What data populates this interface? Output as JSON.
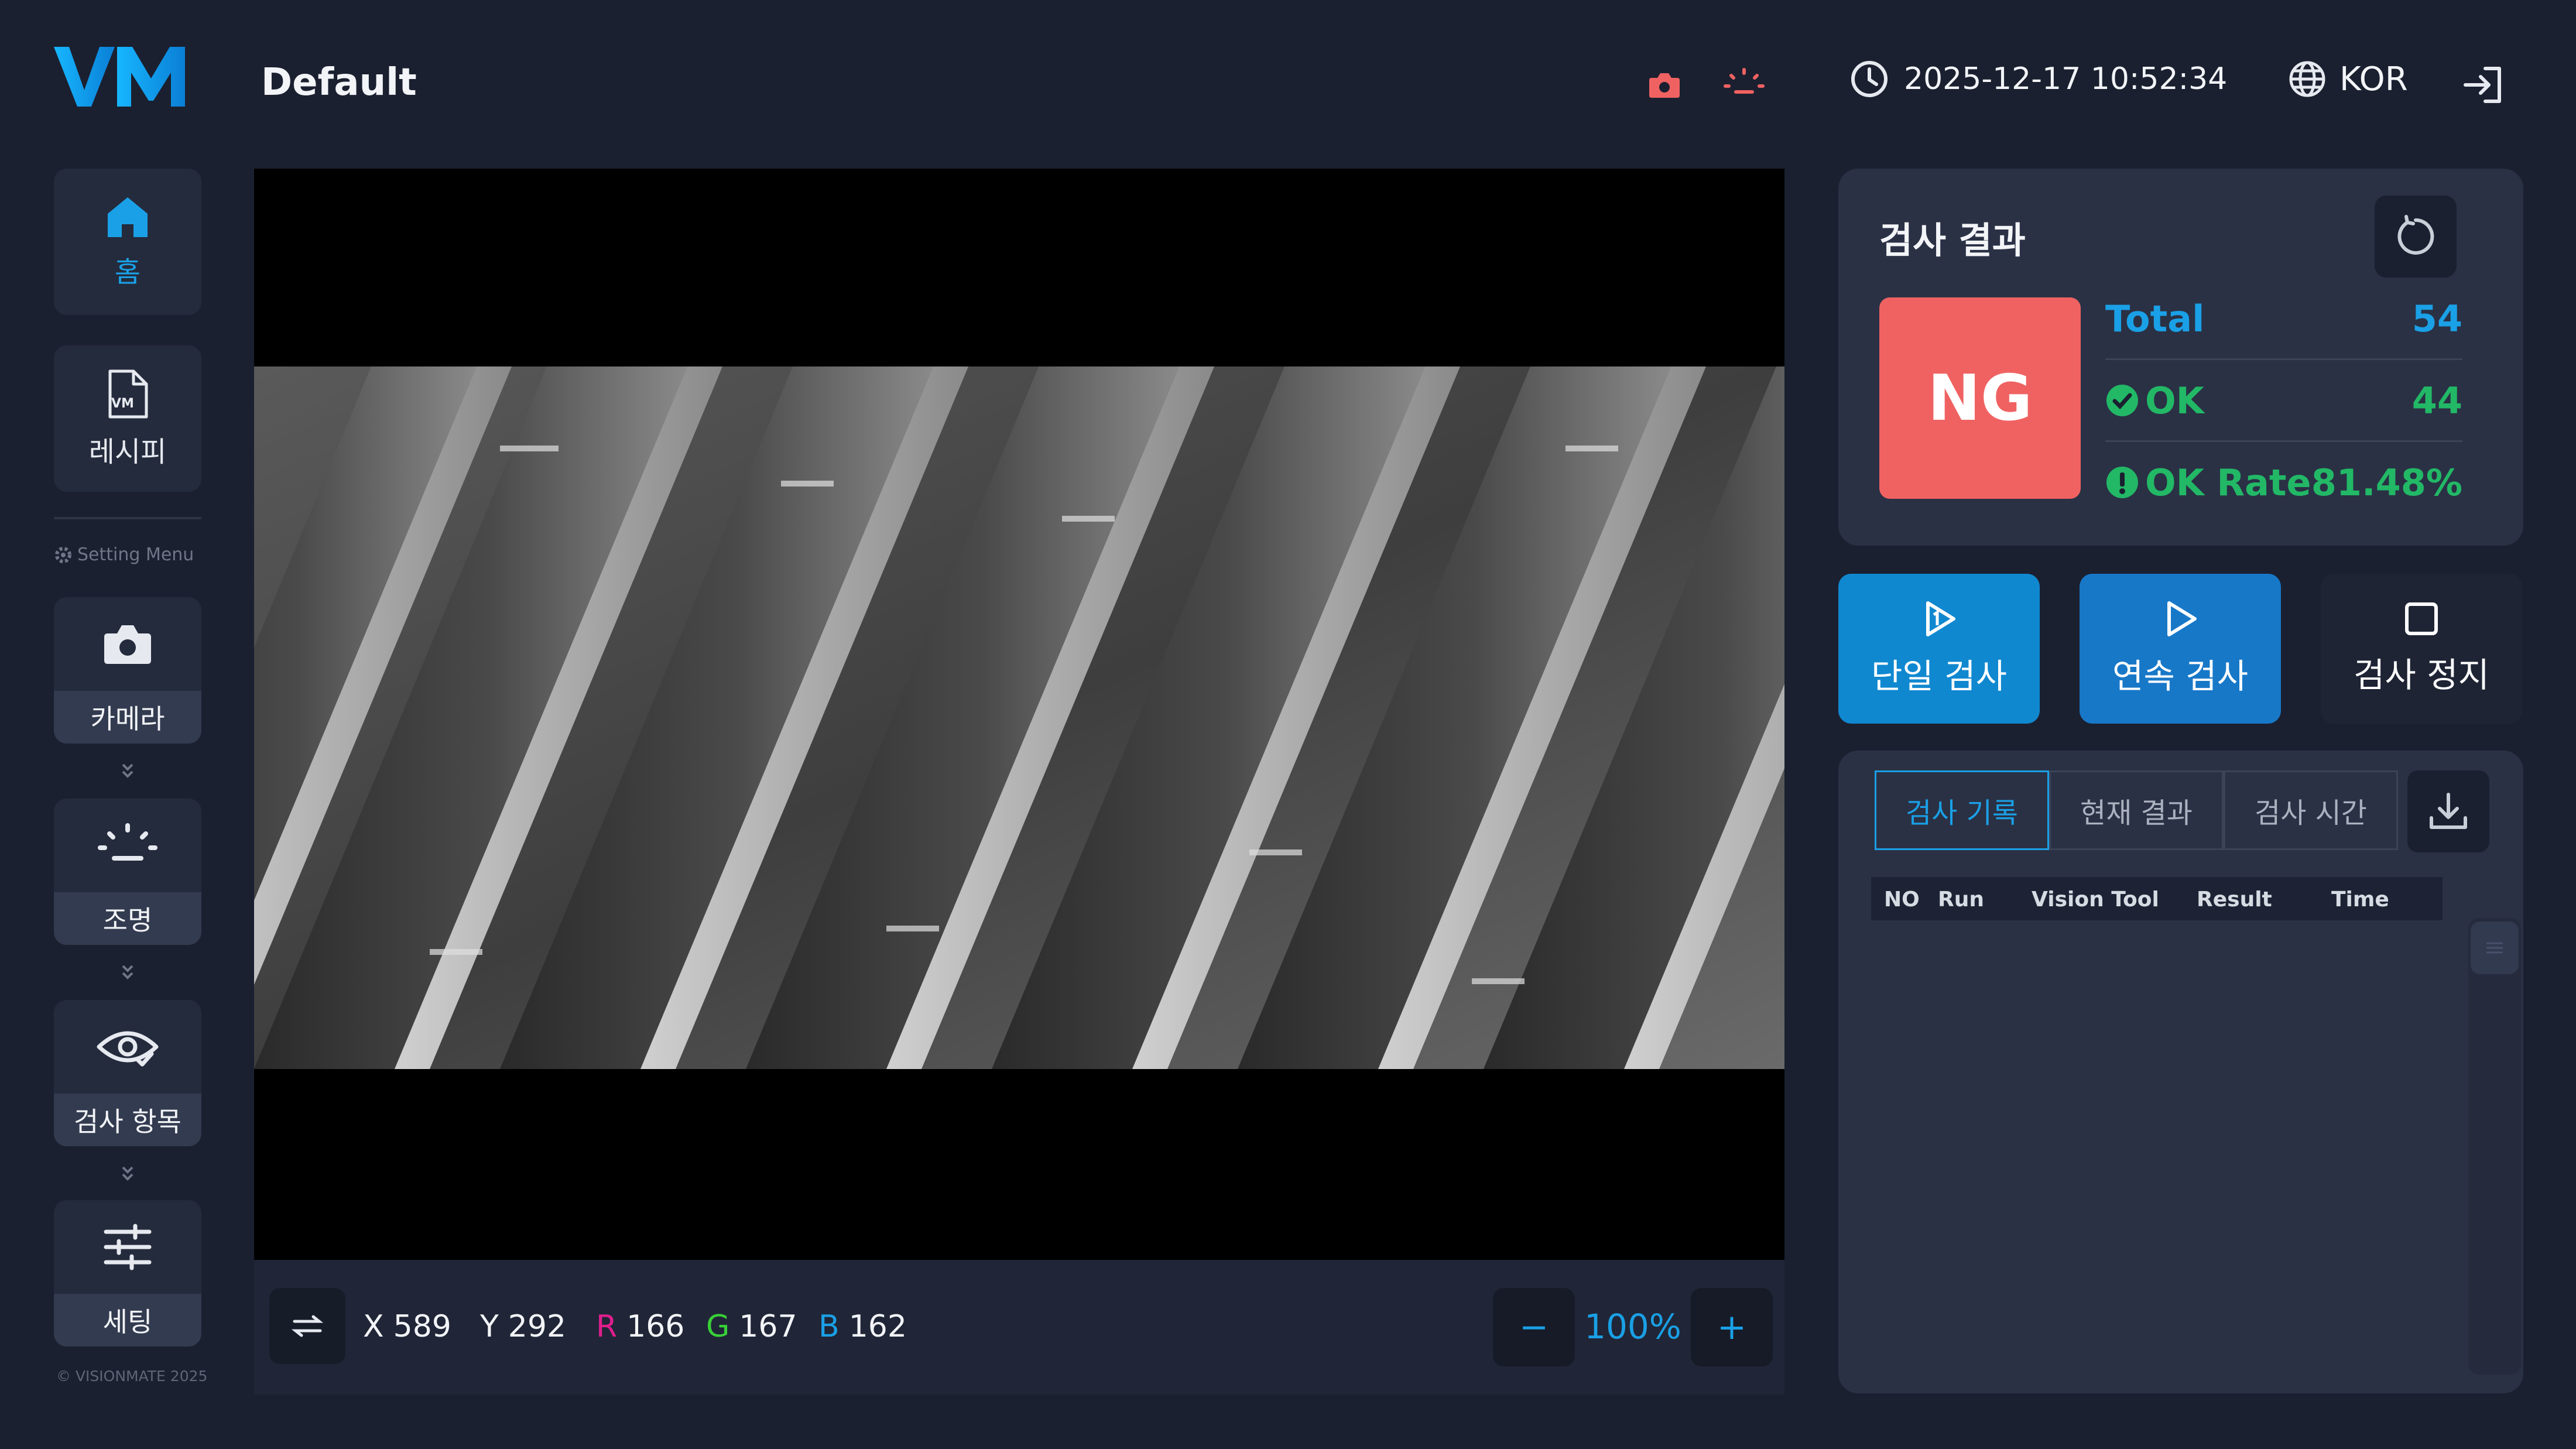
{
  "header": {
    "logo_text": "VM",
    "title": "Default",
    "datetime": "2025-12-17 10:52:34",
    "language": "KOR",
    "icons": [
      "camera-status-icon",
      "light-status-icon",
      "clock-icon",
      "globe-icon",
      "logout-icon"
    ]
  },
  "sidebar": {
    "nav": [
      {
        "label": "홈",
        "icon": "home-icon",
        "active": true
      },
      {
        "label": "레시피",
        "icon": "recipe-file-icon",
        "active": false
      }
    ],
    "setting_menu_label": "Setting Menu",
    "tools": [
      {
        "label": "카메라",
        "icon": "camera-icon"
      },
      {
        "label": "조명",
        "icon": "light-icon"
      },
      {
        "label": "검사 항목",
        "icon": "eye-check-icon"
      },
      {
        "label": "세팅",
        "icon": "sliders-icon"
      }
    ],
    "copyright": "© VISIONMATE 2025"
  },
  "viewer": {
    "pixel_info": {
      "x_label": "X",
      "x": "589",
      "y_label": "Y",
      "y": "292",
      "r_label": "R",
      "r": "166",
      "g_label": "G",
      "g": "167",
      "b_label": "B",
      "b": "162"
    },
    "zoom": "100%",
    "zoom_minus": "−",
    "zoom_plus": "+"
  },
  "result": {
    "title": "검사 결과",
    "verdict": "NG",
    "stats": [
      {
        "label": "Total",
        "value": "54",
        "color": "#1aa0e6",
        "icon": ""
      },
      {
        "label": "OK",
        "value": "44",
        "color": "#22b866",
        "icon": "check-circle-icon"
      },
      {
        "label": "OK Rate",
        "value": "81.48%",
        "color": "#22b866",
        "icon": "alert-circle-icon"
      }
    ]
  },
  "actions": [
    {
      "label": "단일 검사",
      "icon": "play-once-icon",
      "bg": "#1088d0"
    },
    {
      "label": "연속 검사",
      "icon": "play-icon",
      "bg": "#1878c8"
    },
    {
      "label": "검사 정지",
      "icon": "stop-icon",
      "bg": "#1e2434"
    }
  ],
  "log": {
    "tabs": [
      "검사 기록",
      "현재 결과",
      "검사 시간"
    ],
    "active_tab": 0,
    "columns": [
      "NO",
      "Run",
      "Vision Tool",
      "Result",
      "Time"
    ],
    "rows": []
  },
  "colors": {
    "background": "#1b2030",
    "panel": "#2a3145",
    "accent": "#1aa0e6",
    "ng": "#f06262",
    "ok": "#22b866"
  }
}
